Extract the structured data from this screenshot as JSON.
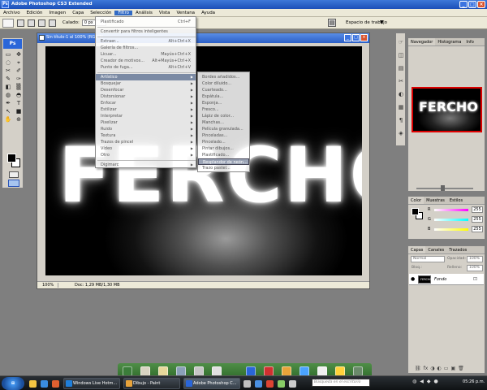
{
  "app": {
    "title": "Adobe Photoshop CS3 Extended",
    "logo": "Ps",
    "window_buttons": [
      "_",
      "□",
      "×"
    ]
  },
  "menubar": {
    "items": [
      "Archivo",
      "Edición",
      "Imagen",
      "Capa",
      "Selección",
      "Filtro",
      "Análisis",
      "Vista",
      "Ventana",
      "Ayuda"
    ],
    "active": "Filtro"
  },
  "options": {
    "calado_label": "Calado:",
    "calado_value": "0 px",
    "workspace_label": "Espacio de trabajo",
    "workspace_arrow": "▼"
  },
  "toolbox": {
    "icons": [
      "▭",
      "✥",
      "◌",
      "⌖",
      "✂",
      "✐",
      "✎",
      "✑",
      "◧",
      "▒",
      "◍",
      "◓",
      "✒",
      "T",
      "↖",
      "■",
      "✋",
      "⊕"
    ]
  },
  "document": {
    "title": "Sin título-1 al 100% (RGB/8)",
    "canvas_text": "FERCHO",
    "zoom": "100%",
    "doc_info": "Doc: 1,29 MB/1,30 MB",
    "buttons": [
      "_",
      "□",
      "×"
    ]
  },
  "filter_menu": {
    "items": [
      {
        "label": "Plastificado",
        "shortcut": "Ctrl+F"
      },
      {
        "label": "Convertir para filtros inteligentes",
        "shortcut": ""
      },
      {
        "label": "Extraer...",
        "shortcut": "Alt+Ctrl+X"
      },
      {
        "label": "Galería de filtros...",
        "shortcut": ""
      },
      {
        "label": "Licuar...",
        "shortcut": "Mayús+Ctrl+X"
      },
      {
        "label": "Creador de motivos...",
        "shortcut": "Alt+Mayús+Ctrl+X"
      },
      {
        "label": "Punto de fuga...",
        "shortcut": "Alt+Ctrl+V"
      },
      {
        "label": "Artístico",
        "shortcut": ""
      },
      {
        "label": "Bosquejar",
        "shortcut": ""
      },
      {
        "label": "Desenfocar",
        "shortcut": ""
      },
      {
        "label": "Distorsionar",
        "shortcut": ""
      },
      {
        "label": "Enfocar",
        "shortcut": ""
      },
      {
        "label": "Estilizar",
        "shortcut": ""
      },
      {
        "label": "Interpretar",
        "shortcut": ""
      },
      {
        "label": "Pixelizar",
        "shortcut": ""
      },
      {
        "label": "Ruido",
        "shortcut": ""
      },
      {
        "label": "Textura",
        "shortcut": ""
      },
      {
        "label": "Trazos de pincel",
        "shortcut": ""
      },
      {
        "label": "Vídeo",
        "shortcut": ""
      },
      {
        "label": "Otro",
        "shortcut": ""
      },
      {
        "label": "Digimarc",
        "shortcut": ""
      }
    ],
    "highlighted": "Artístico"
  },
  "submenu": {
    "items": [
      "Bordes añadidos...",
      "Color diluido...",
      "Cuarteado...",
      "Espátula...",
      "Esponja...",
      "Fresco...",
      "Lápiz de color...",
      "Manchas...",
      "Película granulada...",
      "Pinceladas...",
      "Pincelado...",
      "Pintar dibujos...",
      "Plastificado...",
      "Resplandor de neón...",
      "Trazo pastel..."
    ],
    "highlighted": "Resplandor de neón..."
  },
  "dock": {
    "icons": [
      "☞",
      "◫",
      "▤",
      "✂",
      "◐",
      "▦",
      "¶",
      "◈"
    ]
  },
  "navigator": {
    "tabs": [
      "Navegador",
      "Histograma",
      "Info"
    ],
    "thumb_text": "FERCHO"
  },
  "color_panel": {
    "tabs": [
      "Color",
      "Muestras",
      "Estilos"
    ],
    "channels": [
      {
        "label": "R",
        "value": "255",
        "color": "#ff00ff"
      },
      {
        "label": "G",
        "value": "255",
        "color": "#00ffff"
      },
      {
        "label": "B",
        "value": "255",
        "color": "#ffff00"
      }
    ]
  },
  "layers_panel": {
    "tabs": [
      "Capas",
      "Canales",
      "Trazados"
    ],
    "blend_mode": "Normal",
    "opacity_label": "Opacidad:",
    "opacity_value": "100%",
    "lock_label": "Bloq.:",
    "fill_label": "Relleno:",
    "fill_value": "100%",
    "layer": {
      "name": "Fondo",
      "thumb_text": "FERCHO"
    },
    "bottom_icons": [
      "⛓",
      "fx",
      "◑",
      "◐",
      "▭",
      "▣",
      "🗑"
    ]
  },
  "taskbar": {
    "tasks": [
      {
        "label": "Windows Live Hotm...",
        "icon_color": "#1f7ed9"
      },
      {
        "label": "Dibujo - Paint",
        "icon_color": "#e8a33a"
      },
      {
        "label": "Adobe Photoshop C...",
        "icon_color": "#2a66d9"
      }
    ],
    "search_placeholder": "Búsqueda en el escritorio",
    "clock": "05:26 p.m."
  },
  "colors": {
    "accent": "#316ac5",
    "title_blue": "#2b5fc7",
    "close_red": "#d9542f",
    "menu_highlight": "#7b8aa4"
  }
}
